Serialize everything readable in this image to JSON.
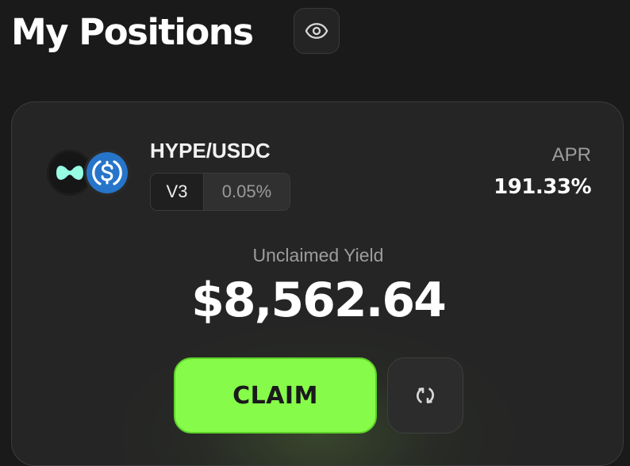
{
  "header": {
    "title": "My Positions",
    "visibility_icon": "eye-icon"
  },
  "position": {
    "pair": "HYPE/USDC",
    "tokens": [
      {
        "symbol": "HYPE",
        "icon": "hype-token-icon",
        "color": "#97fce4"
      },
      {
        "symbol": "USDC",
        "icon": "usdc-token-icon",
        "color": "#2775ca"
      }
    ],
    "version": "V3",
    "fee_tier": "0.05%",
    "apr_label": "APR",
    "apr_value": "191.33%",
    "yield_label": "Unclaimed Yield",
    "yield_value": "$8,562.64",
    "claim_label": "CLAIM",
    "refresh_icon": "refresh-icon"
  },
  "colors": {
    "background": "#1a1a1a",
    "card": "#252525",
    "accent": "#86fb4a",
    "muted_text": "#9d9d9d"
  }
}
